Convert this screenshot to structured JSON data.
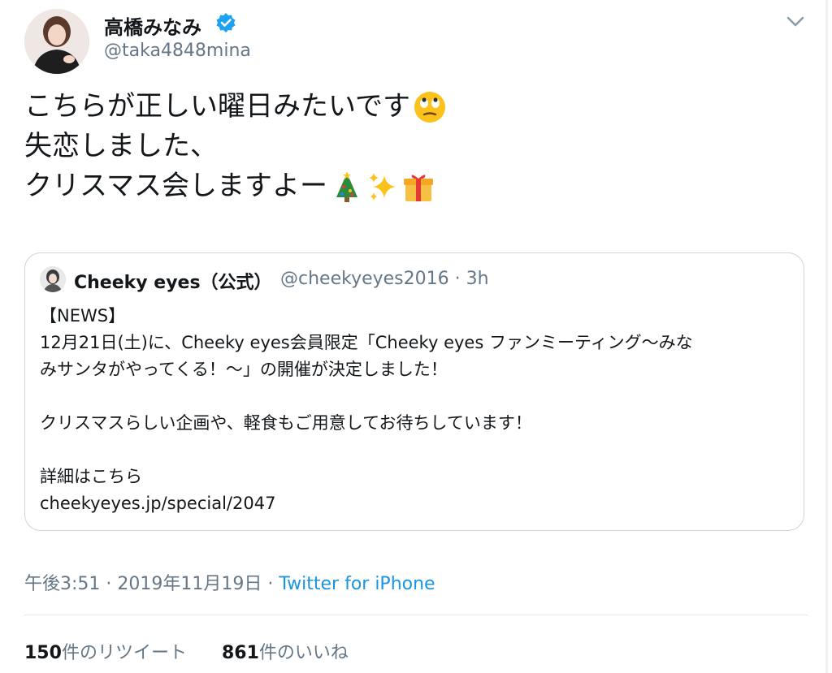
{
  "author": {
    "display_name": "高橋みなみ",
    "handle": "@taka4848mina",
    "verified": true
  },
  "tweet": {
    "lines": [
      "こちらが正しい曜日みたいです",
      "失恋しました、",
      "クリスマス会しますよー"
    ],
    "emoji": [
      "face-with-rolling-eyes",
      "christmas-tree",
      "sparkles",
      "wrapped-gift"
    ]
  },
  "quote": {
    "name": "Cheeky eyes（公式）",
    "meta": "@cheekyeyes2016 · 3h",
    "lines": [
      "【NEWS】",
      "12月21日(土)に、Cheeky eyes会員限定「Cheeky eyes ファンミーティング〜みな",
      "みサンタがやってくる！〜」の開催が決定しました！",
      "",
      "クリスマスらしい企画や、軽食もご用意してお待ちしています！",
      "",
      "詳細はこちら",
      "cheekyeyes.jp/special/2047"
    ]
  },
  "timestamp": {
    "time": "午後3:51 · 2019年11月19日 · ",
    "source": "Twitter for iPhone"
  },
  "stats": {
    "retweet_count": "150",
    "retweet_label": "件のリツイート",
    "like_count": "861",
    "like_label": "件のいいね"
  },
  "colors": {
    "verified_blue": "#1da1f2",
    "link_blue": "#1b95e0",
    "secondary_text": "#657786"
  }
}
